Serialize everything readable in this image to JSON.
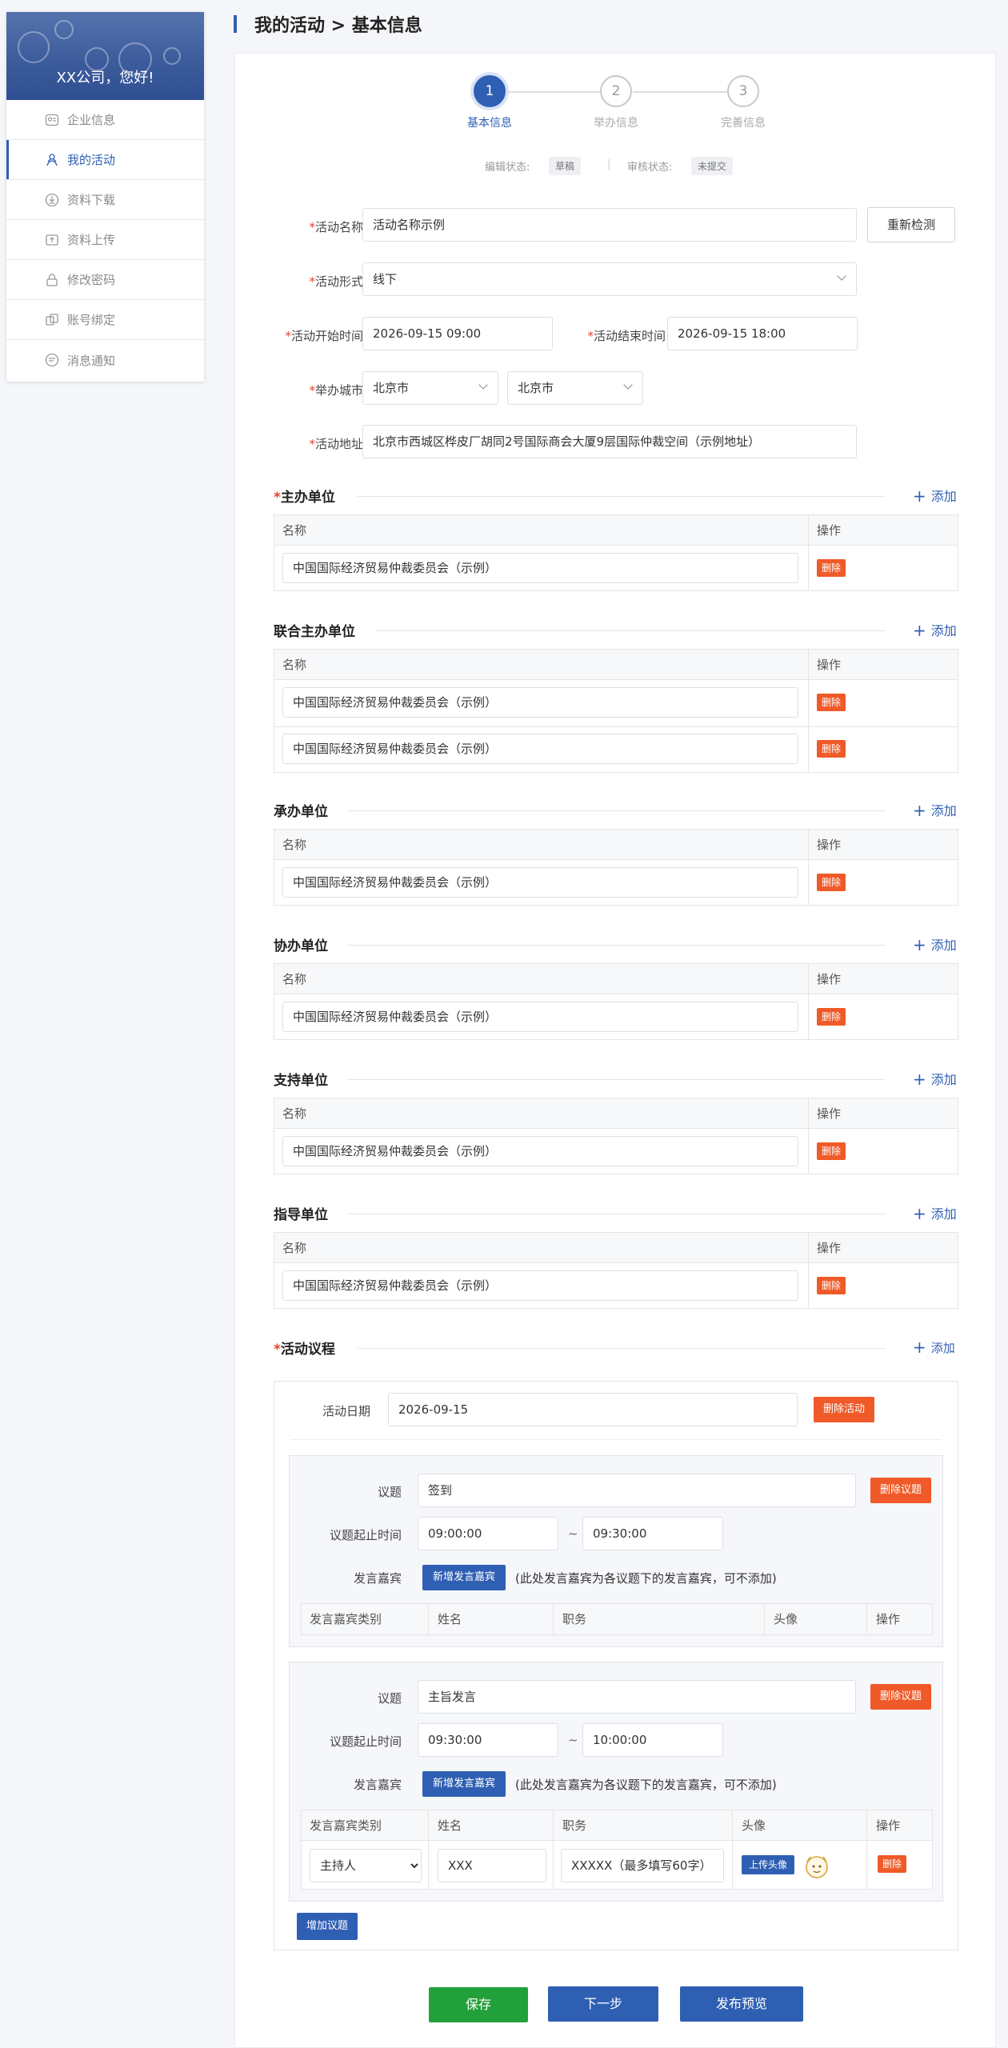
{
  "sidebar": {
    "greeting": "XX公司，您好!",
    "items": [
      {
        "label": "企业信息"
      },
      {
        "label": "我的活动"
      },
      {
        "label": "资料下载"
      },
      {
        "label": "资料上传"
      },
      {
        "label": "修改密码"
      },
      {
        "label": "账号绑定"
      },
      {
        "label": "消息通知"
      }
    ]
  },
  "page": {
    "breadcrumb": "我的活动 > 基本信息"
  },
  "steps": [
    {
      "num": "1",
      "label": "基本信息"
    },
    {
      "num": "2",
      "label": "举办信息"
    },
    {
      "num": "3",
      "label": "完善信息"
    }
  ],
  "status": {
    "edit_label": "编辑状态:",
    "edit_value": "草稿",
    "divider": "|",
    "review_label": "审核状态:",
    "review_value": "未提交"
  },
  "form": {
    "required_mark": "*",
    "name_label": "活动名称",
    "name_value": "活动名称示例",
    "recheck_button": "重新检测",
    "form_label": "活动形式",
    "form_value": "线下",
    "start_label": "活动开始时间",
    "start_value": "2026-09-15 09:00",
    "end_label": "活动结束时间",
    "end_value": "2026-09-15 18:00",
    "city_label": "举办城市",
    "province_value": "北京市",
    "city_value": "北京市",
    "address_label": "活动地址",
    "address_value": "北京市西城区桦皮厂胡同2号国际商会大厦9层国际仲裁空间（示例地址）"
  },
  "common": {
    "add_label": "添加",
    "add_symbol": "+",
    "col_name": "名称",
    "col_op": "操作",
    "delete_label": "删除"
  },
  "sections": {
    "host": {
      "title": "主办单位",
      "rows": [
        "中国国际经济贸易仲裁委员会（示例）"
      ]
    },
    "co_host": {
      "title": "联合主办单位",
      "rows": [
        "中国国际经济贸易仲裁委员会（示例）",
        "中国国际经济贸易仲裁委员会（示例）"
      ]
    },
    "organizer": {
      "title": "承办单位",
      "rows": [
        "中国国际经济贸易仲裁委员会（示例）"
      ]
    },
    "co_organizer": {
      "title": "协办单位",
      "rows": [
        "中国国际经济贸易仲裁委员会（示例）"
      ]
    },
    "supporter": {
      "title": "支持单位",
      "rows": [
        "中国国际经济贸易仲裁委员会（示例）"
      ]
    },
    "guide": {
      "title": "指导单位",
      "rows": [
        "中国国际经济贸易仲裁委员会（示例）"
      ]
    }
  },
  "agenda": {
    "title": "活动议程",
    "add_label": "添加",
    "date_label": "活动日期",
    "date_value": "2026-09-15",
    "delete_activity": "删除活动",
    "topic_label": "议题",
    "time_label": "议题起止时间",
    "tilde": "~",
    "speaker_label": "发言嘉宾",
    "add_speaker_button": "新增发言嘉宾",
    "speaker_note": "(此处发言嘉宾为各议题下的发言嘉宾，可不添加)",
    "delete_topic": "删除议题",
    "columns": [
      "发言嘉宾类别",
      "姓名",
      "职务",
      "头像",
      "操作"
    ],
    "topics": [
      {
        "title": "签到",
        "start": "09:00:00",
        "end": "09:30:00"
      },
      {
        "title": "主旨发言",
        "start": "09:30:00",
        "end": "10:00:00"
      }
    ],
    "speaker": {
      "category": "主持人",
      "name": "XXX",
      "position": "XXXXX（最多填写60字）",
      "upload_avatar": "上传头像",
      "delete": "删除"
    },
    "add_topic_button": "增加议题"
  },
  "footer": {
    "save": "保存",
    "next": "下一步",
    "preview": "发布预览"
  },
  "colors": {
    "primary": "#2f5fb3",
    "danger": "#ef5a28",
    "success": "#22a03a"
  }
}
